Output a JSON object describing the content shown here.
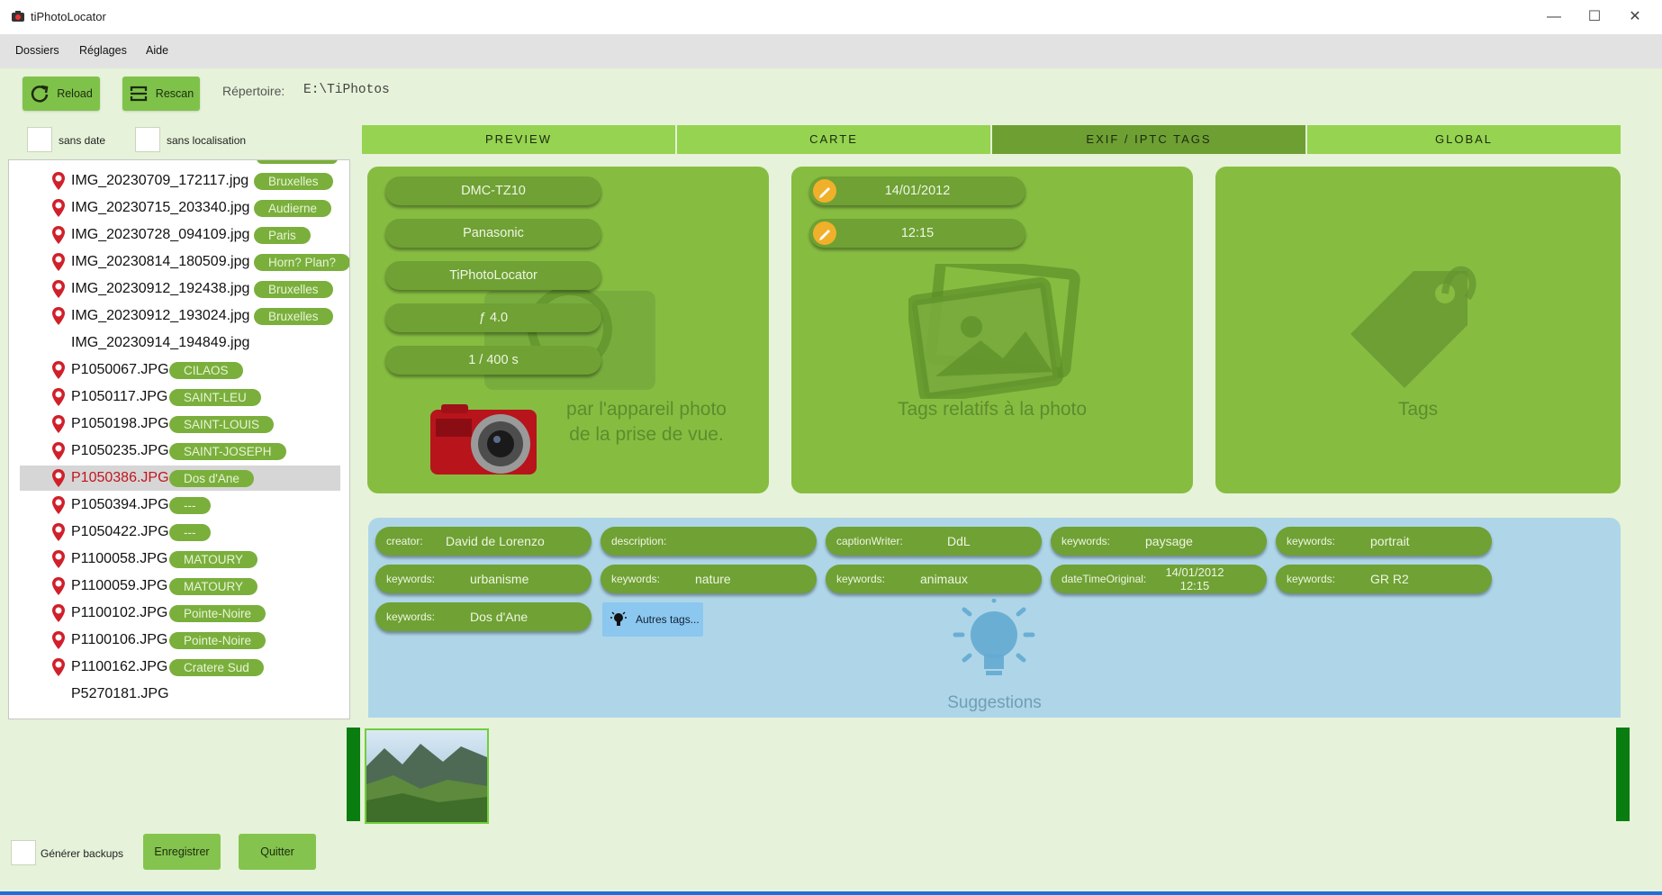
{
  "app": {
    "title": "tiPhotoLocator"
  },
  "window_controls": {
    "minimize": "—",
    "maximize": "☐",
    "close": "✕"
  },
  "menu": {
    "items": [
      "Dossiers",
      "Réglages",
      "Aide"
    ]
  },
  "toolbar": {
    "reload_label": "Reload",
    "rescan_label": "Rescan",
    "repertoire_label": "Répertoire:",
    "repertoire_value": "E:\\TiPhotos"
  },
  "filters": {
    "sans_date": "sans date",
    "sans_localisation": "sans localisation"
  },
  "tabs": [
    {
      "label": "PREVIEW",
      "active": false
    },
    {
      "label": "CARTE",
      "active": false
    },
    {
      "label": "EXIF / IPTC TAGS",
      "active": true
    },
    {
      "label": "GLOBAL",
      "active": false
    }
  ],
  "files": [
    {
      "name": "IMG_20230709_172117.jpg",
      "location": "Bruxelles",
      "pin": true,
      "selected": false
    },
    {
      "name": "IMG_20230715_203340.jpg",
      "location": "Audierne",
      "pin": true,
      "selected": false
    },
    {
      "name": "IMG_20230728_094109.jpg",
      "location": "Paris",
      "pin": true,
      "selected": false
    },
    {
      "name": "IMG_20230814_180509.jpg",
      "location": "Horn? Plan?",
      "pin": true,
      "selected": false
    },
    {
      "name": "IMG_20230912_192438.jpg",
      "location": "Bruxelles",
      "pin": true,
      "selected": false
    },
    {
      "name": "IMG_20230912_193024.jpg",
      "location": "Bruxelles",
      "pin": true,
      "selected": false
    },
    {
      "name": "IMG_20230914_194849.jpg",
      "location": "",
      "pin": false,
      "selected": false
    },
    {
      "name": "P1050067.JPG",
      "location": "CILAOS",
      "pin": true,
      "selected": false
    },
    {
      "name": "P1050117.JPG",
      "location": "SAINT-LEU",
      "pin": true,
      "selected": false
    },
    {
      "name": "P1050198.JPG",
      "location": "SAINT-LOUIS",
      "pin": true,
      "selected": false
    },
    {
      "name": "P1050235.JPG",
      "location": "SAINT-JOSEPH",
      "pin": true,
      "selected": false
    },
    {
      "name": "P1050386.JPG",
      "location": "Dos d'Ane",
      "pin": true,
      "selected": true
    },
    {
      "name": "P1050394.JPG",
      "location": "---",
      "pin": true,
      "selected": false
    },
    {
      "name": "P1050422.JPG",
      "location": "---",
      "pin": true,
      "selected": false
    },
    {
      "name": "P1100058.JPG",
      "location": "MATOURY",
      "pin": true,
      "selected": false
    },
    {
      "name": "P1100059.JPG",
      "location": "MATOURY",
      "pin": true,
      "selected": false
    },
    {
      "name": "P1100102.JPG",
      "location": "Pointe-Noire",
      "pin": true,
      "selected": false
    },
    {
      "name": "P1100106.JPG",
      "location": "Pointe-Noire",
      "pin": true,
      "selected": false
    },
    {
      "name": "P1100162.JPG",
      "location": "Cratere Sud",
      "pin": true,
      "selected": false
    },
    {
      "name": "P5270181.JPG",
      "location": "",
      "pin": false,
      "selected": false
    }
  ],
  "camera_panel": {
    "model": "DMC-TZ10",
    "make": "Panasonic",
    "software": "TiPhotoLocator",
    "aperture": "ƒ 4.0",
    "exposure": "1 / 400 s",
    "ghost_line1": "par l'appareil photo",
    "ghost_line2": "de la prise de vue."
  },
  "date_panel": {
    "date": "14/01/2012",
    "time": "12:15",
    "ghost_text": "Tags relatifs à la photo"
  },
  "tags_panel": {
    "ghost_text": "Tags"
  },
  "suggestions": {
    "ghost_text": "Suggestions",
    "tags": [
      {
        "key": "creator:",
        "value": "David de Lorenzo"
      },
      {
        "key": "description:",
        "value": ""
      },
      {
        "key": "captionWriter:",
        "value": "DdL"
      },
      {
        "key": "keywords:",
        "value": "paysage"
      },
      {
        "key": "keywords:",
        "value": "portrait"
      },
      {
        "key": "keywords:",
        "value": "urbanisme"
      },
      {
        "key": "keywords:",
        "value": "nature"
      },
      {
        "key": "keywords:",
        "value": "animaux"
      },
      {
        "key": "dateTimeOriginal:",
        "value": "14/01/2012 12:15"
      },
      {
        "key": "keywords:",
        "value": "GR R2"
      },
      {
        "key": "keywords:",
        "value": "Dos d'Ane"
      }
    ],
    "autres_label": "Autres tags..."
  },
  "bottom": {
    "generer_backups": "Générer backups",
    "enregistrer": "Enregistrer",
    "quitter": "Quitter"
  },
  "colors": {
    "panel_green": "#86bd41",
    "pill_green": "#6fa134",
    "tab_green": "#96d351",
    "tab_active": "#6e9f33",
    "suggest_blue": "#aed6e8",
    "pin_red": "#d0202a"
  }
}
